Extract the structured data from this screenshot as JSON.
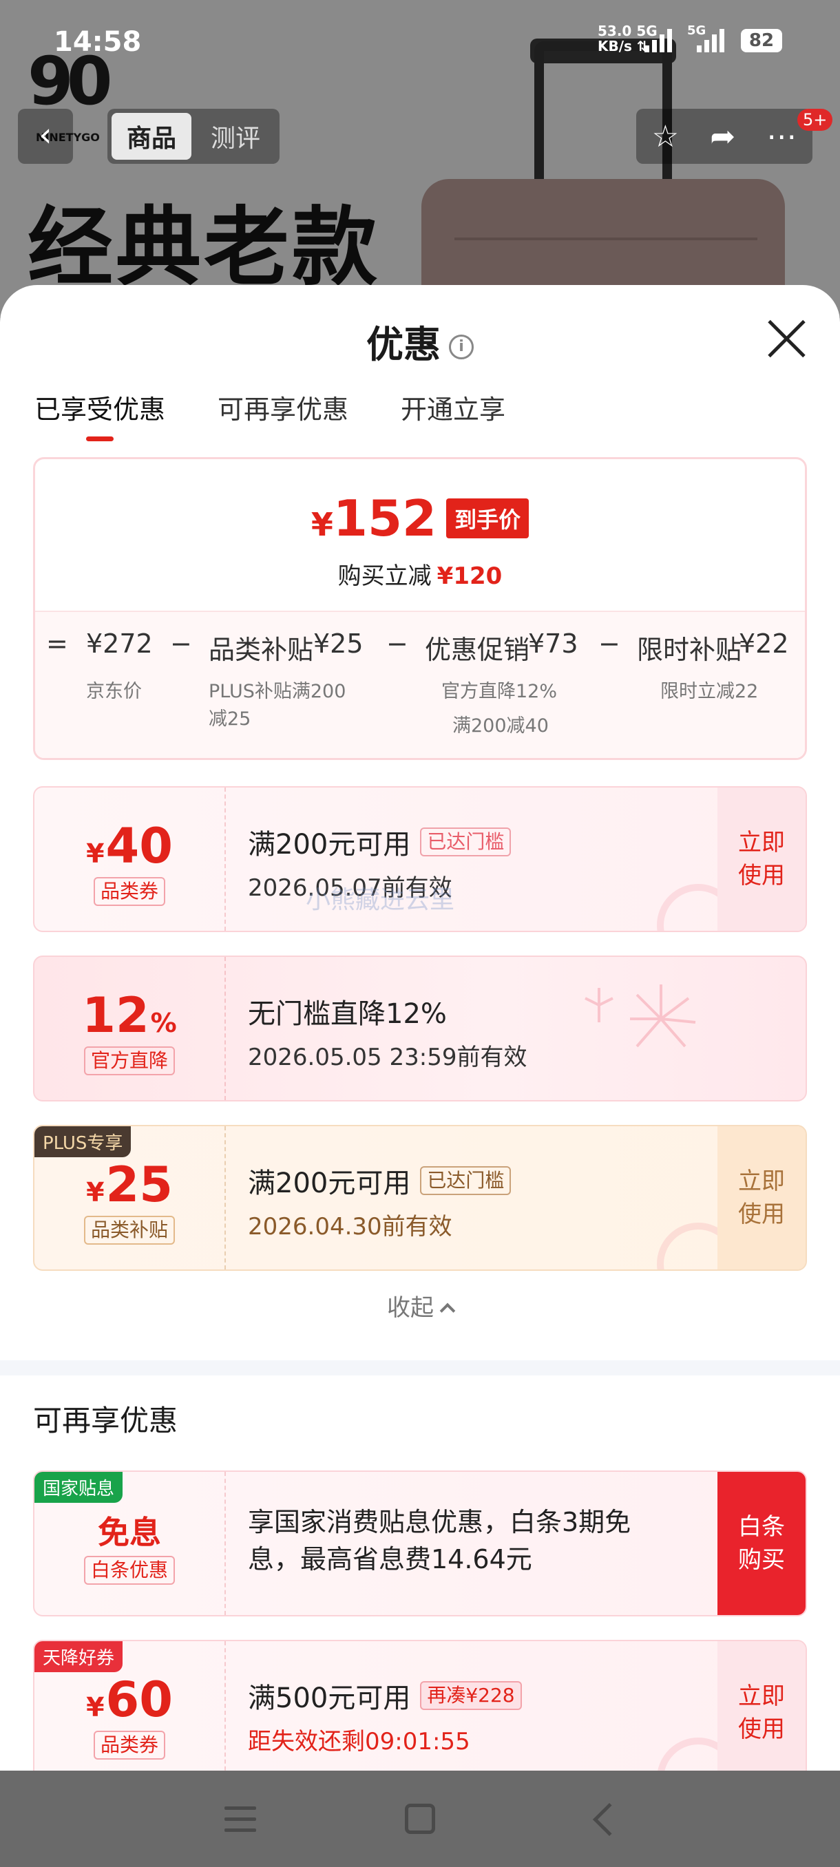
{
  "status": {
    "time": "14:58",
    "net_speed_top": "53.0",
    "net_speed_unit": "KB/s",
    "net_type_1": "5G",
    "net_type_2": "5G",
    "battery": "82"
  },
  "product": {
    "brand_mark": "90",
    "brand_text": "NINETYGO",
    "tabs": [
      {
        "label": "商品",
        "active": true
      },
      {
        "label": "测评",
        "active": false
      }
    ],
    "cart_badge": "5+",
    "hero_title": "经典老款"
  },
  "sheet": {
    "title": "优惠",
    "tabs": [
      {
        "label": "已享受优惠",
        "active": true
      },
      {
        "label": "可再享优惠",
        "active": false
      },
      {
        "label": "开通立享",
        "active": false
      }
    ],
    "summary": {
      "currency": "¥",
      "final_price": "152",
      "final_tag": "到手价",
      "reduce_label": "购买立减",
      "reduce_amount": "¥120",
      "calc": {
        "eq": "=",
        "base_price": "¥272",
        "base_label": "京东价",
        "minus": "−",
        "item1_label": "品类补贴",
        "item1_value": "¥25",
        "item1_sub_line1": "PLUS补贴满200",
        "item1_sub_line2": "减25",
        "item2_label": "优惠促销",
        "item2_value": "¥73",
        "item2_sub_line1": "官方直降12%",
        "item2_sub_line2": "满200减40",
        "item3_label": "限时补贴",
        "item3_value": "¥22",
        "item3_sub": "限时立减22"
      }
    },
    "coupons": [
      {
        "yen": "¥",
        "amount": "40",
        "type": "品类券",
        "condition": "满200元可用",
        "status_tag": "已达门槛",
        "validity": "2026.05.07前有效",
        "action": "立即使用",
        "action_line1": "立即",
        "action_line2": "使用"
      },
      {
        "amount": "12",
        "pct": "%",
        "type": "官方直降",
        "condition": "无门槛直降12%",
        "validity": "2026.05.05 23:59前有效"
      },
      {
        "corner": "PLUS专享",
        "yen": "¥",
        "amount": "25",
        "type": "品类补贴",
        "condition": "满200元可用",
        "status_tag": "已达门槛",
        "validity": "2026.04.30前有效",
        "action_line1": "立即",
        "action_line2": "使用"
      }
    ],
    "collapse_label": "收起",
    "more_section_title": "可再享优惠",
    "more": [
      {
        "corner": "国家贴息",
        "headline": "免息",
        "type": "白条优惠",
        "desc_line1": "享国家消费贴息优惠，白条3期免",
        "desc_line2": "息，最高省息费14.64元",
        "action_line1": "白条",
        "action_line2": "购买"
      },
      {
        "corner": "天降好券",
        "yen": "¥",
        "amount": "60",
        "type": "品类券",
        "condition": "满500元可用",
        "status_tag": "再凑¥228",
        "countdown": "距失效还剩09:01:55",
        "action_line1": "立即",
        "action_line2": "使用"
      }
    ],
    "watermark": "小熊藏进云里"
  },
  "colors": {
    "accent_red": "#e2231a",
    "plus_gold": "#a8723a"
  }
}
